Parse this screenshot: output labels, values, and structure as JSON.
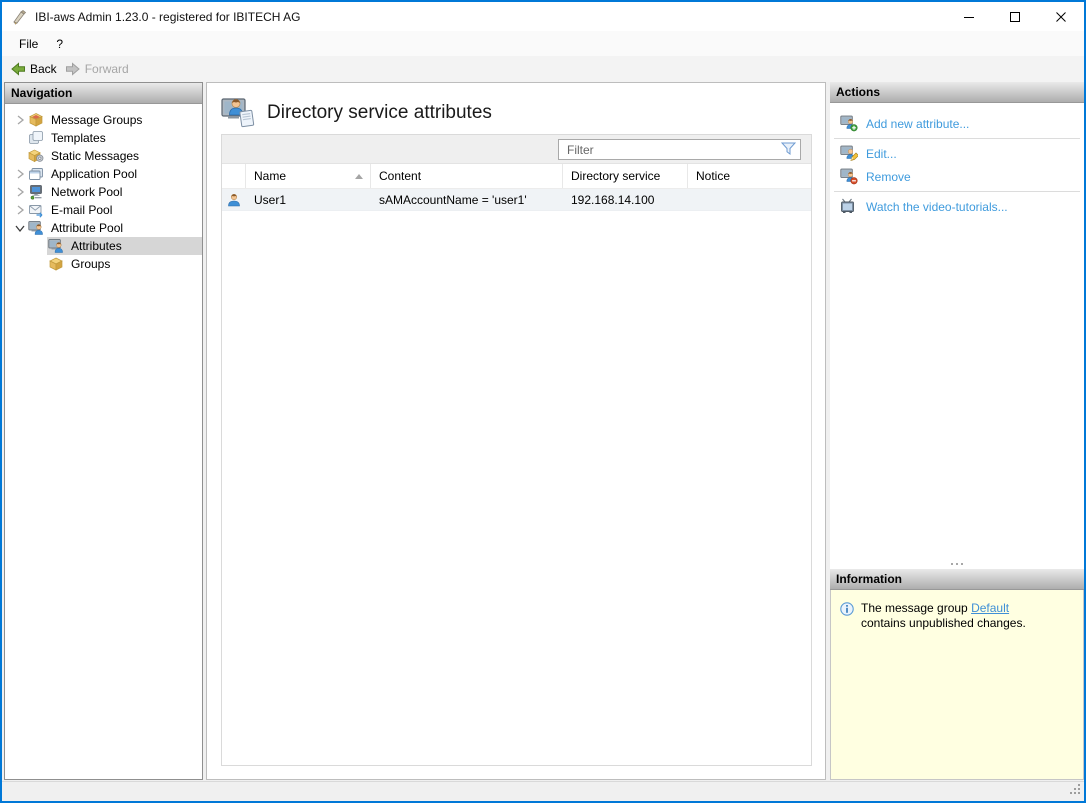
{
  "window": {
    "title": "IBI-aws Admin 1.23.0 - registered for IBITECH AG",
    "controls": [
      "minimize",
      "maximize",
      "close"
    ]
  },
  "menu": {
    "file": "File",
    "help": "?"
  },
  "toolbar": {
    "back": "Back",
    "forward": "Forward"
  },
  "navigation": {
    "header": "Navigation",
    "items": [
      {
        "label": "Message Groups",
        "icon": "message-groups-icon",
        "chevron": "collapsed",
        "depth": 0,
        "selected": false
      },
      {
        "label": "Templates",
        "icon": "templates-icon",
        "chevron": "none",
        "depth": 0,
        "selected": false
      },
      {
        "label": "Static Messages",
        "icon": "static-messages-icon",
        "chevron": "none",
        "depth": 0,
        "selected": false
      },
      {
        "label": "Application Pool",
        "icon": "application-pool-icon",
        "chevron": "collapsed",
        "depth": 0,
        "selected": false
      },
      {
        "label": "Network Pool",
        "icon": "network-pool-icon",
        "chevron": "collapsed",
        "depth": 0,
        "selected": false
      },
      {
        "label": "E-mail Pool",
        "icon": "email-pool-icon",
        "chevron": "collapsed",
        "depth": 0,
        "selected": false
      },
      {
        "label": "Attribute Pool",
        "icon": "attribute-pool-icon",
        "chevron": "expanded",
        "depth": 0,
        "selected": false
      },
      {
        "label": "Attributes",
        "icon": "attributes-icon",
        "chevron": "none",
        "depth": 1,
        "selected": true
      },
      {
        "label": "Groups",
        "icon": "groups-icon",
        "chevron": "none",
        "depth": 1,
        "selected": false
      }
    ]
  },
  "main": {
    "title": "Directory service attributes",
    "filter": {
      "placeholder": "Filter"
    },
    "table": {
      "columns": {
        "name": "Name",
        "content": "Content",
        "directory_service": "Directory service",
        "notice": "Notice"
      },
      "sort": {
        "column": "Name",
        "direction": "ascending"
      },
      "rows": [
        {
          "name": "User1",
          "content": "sAMAccountName = 'user1'",
          "directory_service": "192.168.14.100",
          "notice": ""
        }
      ]
    }
  },
  "actions": {
    "header": "Actions",
    "items": [
      {
        "label": "Add new attribute...",
        "icon": "add-attribute-icon"
      },
      {
        "label": "Edit...",
        "icon": "edit-attribute-icon"
      },
      {
        "label": "Remove",
        "icon": "remove-attribute-icon"
      },
      {
        "label": "Watch the video-tutorials...",
        "icon": "video-tutorials-icon"
      }
    ]
  },
  "information": {
    "header": "Information",
    "message_prefix": "The message group ",
    "message_link": "Default",
    "message_suffix": " contains unpublished changes."
  },
  "colors": {
    "accent": "#0078D7",
    "link": "#3f9bdd",
    "info_bg": "#ffffe1",
    "selection": "#d6d6d6"
  }
}
